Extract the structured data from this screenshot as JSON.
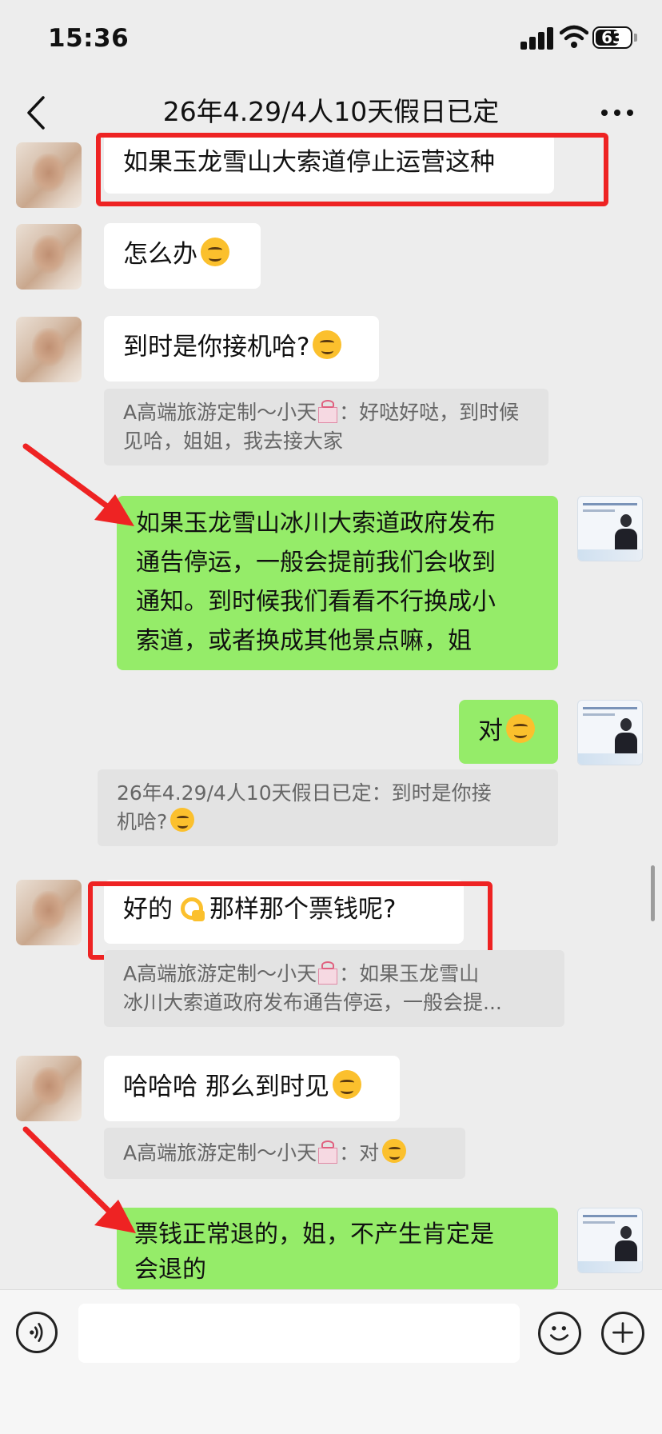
{
  "status_bar": {
    "time": "15:36",
    "battery_level": "63"
  },
  "header": {
    "title": "26年4.29/4人10天假日已定"
  },
  "messages": [
    {
      "text": "如果玉龙雪山大索道停止运营这种"
    },
    {
      "text": "怎么办"
    },
    {
      "text": "到时是你接机哈?"
    },
    {
      "quote_prefix": "A高端旅游定制～小天",
      "quote_text": "：好哒好哒，到时候见哈，姐姐，我去接大家"
    },
    {
      "text_lines": [
        "如果玉龙雪山冰川大索道政府发布",
        "通告停运，一般会提前我们会收到",
        "通知。到时候我们看看不行换成小",
        "索道，或者换成其他景点嘛，姐"
      ]
    },
    {
      "text": "对"
    },
    {
      "quote_prefix": "26年4.29/4人10天假日已定",
      "quote_text": "：到时是你接",
      "quote_line2": "机哈?"
    },
    {
      "text_a": "好的",
      "text_b": "那样那个票钱呢?"
    },
    {
      "quote_prefix": "A高端旅游定制～小天",
      "quote_text": "：如果玉龙雪山",
      "quote_line2": "冰川大索道政府发布通告停运，一般会提..."
    },
    {
      "text": "哈哈哈 那么到时见"
    },
    {
      "quote_prefix": "A高端旅游定制～小天",
      "quote_text": "：对"
    },
    {
      "text_lines": [
        "票钱正常退的，姐，不产生肯定是",
        "会退的"
      ]
    }
  ],
  "input": {
    "placeholder": ""
  },
  "icons": {
    "back": "chevron-left-icon",
    "more": "more-icon",
    "voice": "voice-icon",
    "emoji": "emoji-icon",
    "plus": "plus-icon"
  },
  "colors": {
    "background": "#ededed",
    "outgoing_bubble": "#95ec69",
    "incoming_bubble": "#ffffff",
    "annotation_red": "#ee2323"
  }
}
